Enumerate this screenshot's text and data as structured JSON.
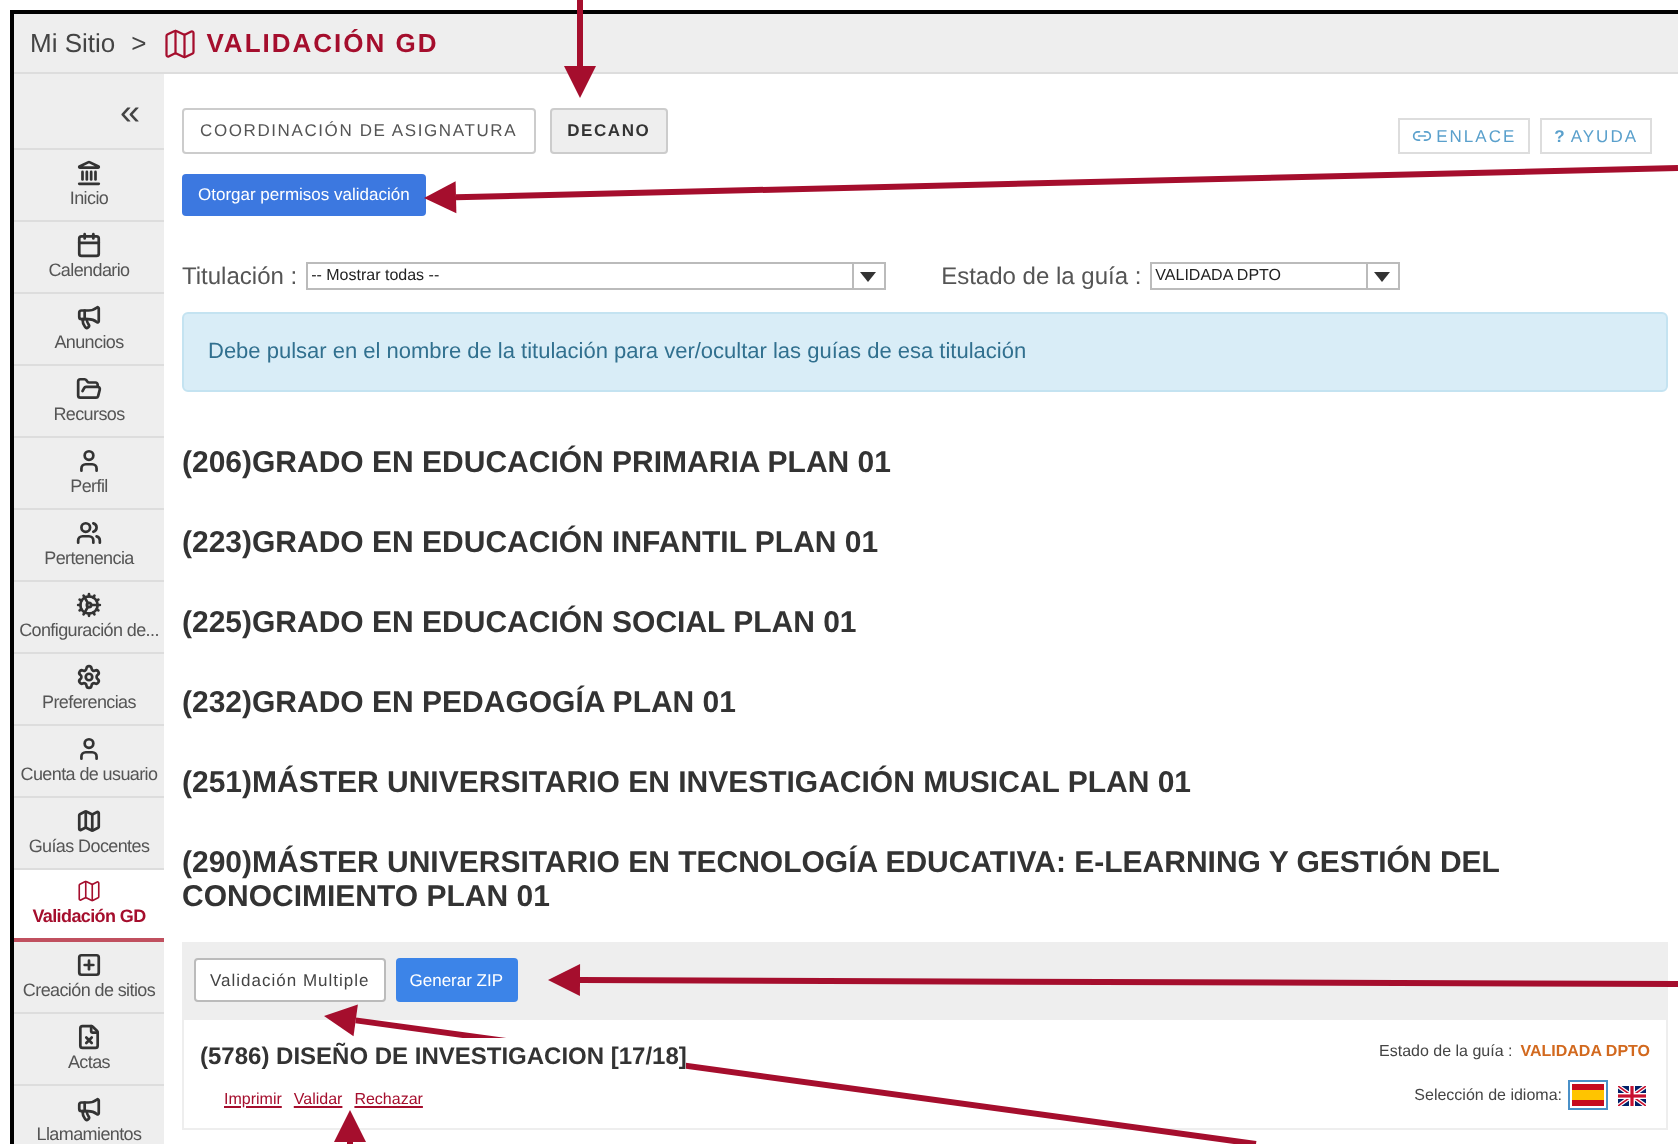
{
  "breadcrumb": {
    "root": "Mi Sitio",
    "separator": ">",
    "current": "VALIDACIÓN GD"
  },
  "sidebar": {
    "collapse": "«",
    "items": [
      {
        "label": "Inicio",
        "selected": false
      },
      {
        "label": "Calendario",
        "selected": false
      },
      {
        "label": "Anuncios",
        "selected": false
      },
      {
        "label": "Recursos",
        "selected": false
      },
      {
        "label": "Perfil",
        "selected": false
      },
      {
        "label": "Pertenencia",
        "selected": false
      },
      {
        "label": "Configuración de...",
        "selected": false
      },
      {
        "label": "Preferencias",
        "selected": false
      },
      {
        "label": "Cuenta de usuario",
        "selected": false
      },
      {
        "label": "Guías Docentes",
        "selected": false
      },
      {
        "label": "Validación GD",
        "selected": true
      },
      {
        "label": "Creación de sitios",
        "selected": false
      },
      {
        "label": "Actas",
        "selected": false
      },
      {
        "label": "Llamamientos",
        "selected": false
      }
    ]
  },
  "role_tabs": [
    {
      "label": "COORDINACIÓN DE ASIGNATURA",
      "selected": false
    },
    {
      "label": "DECANO",
      "selected": true
    }
  ],
  "top_links": [
    {
      "kind": "link",
      "label": "ENLACE"
    },
    {
      "kind": "help",
      "symbol": "?",
      "label": "AYUDA"
    }
  ],
  "grant_button": "Otorgar permisos validación",
  "filters": [
    {
      "label": "Titulación :",
      "value": "-- Mostrar todas --",
      "kind": "wide"
    },
    {
      "label": "Estado de la guía :",
      "value": "VALIDADA DPTO",
      "kind": "narrow"
    }
  ],
  "info": "Debe pulsar en el nombre de la titulación para ver/ocultar las guías de esa titulación",
  "degrees": [
    "(206)GRADO EN EDUCACIÓN PRIMARIA PLAN 01",
    "(223)GRADO EN EDUCACIÓN INFANTIL PLAN 01",
    "(225)GRADO EN EDUCACIÓN SOCIAL PLAN 01",
    "(232)GRADO EN PEDAGOGÍA PLAN 01",
    "(251)MÁSTER UNIVERSITARIO EN INVESTIGACIÓN MUSICAL PLAN 01",
    "(290)MÁSTER UNIVERSITARIO EN TECNOLOGÍA EDUCATIVA: E-LEARNING Y GESTIÓN DEL CONOCIMIENTO PLAN 01"
  ],
  "toolbar": [
    {
      "label": "Validación Multiple",
      "kind": "default"
    },
    {
      "label": "Generar ZIP",
      "kind": "primary"
    }
  ],
  "guide": {
    "title": "(5786) DISEÑO DE INVESTIGACION [17/18]",
    "actions": [
      "Imprimir",
      "Validar",
      "Rechazar"
    ],
    "status_label": "Estado de la guía :",
    "status": "VALIDADA DPTO",
    "language_label": "Selección de idioma:",
    "languages": [
      {
        "kind": "es",
        "selected": true
      },
      {
        "kind": "gb",
        "selected": false
      }
    ]
  }
}
